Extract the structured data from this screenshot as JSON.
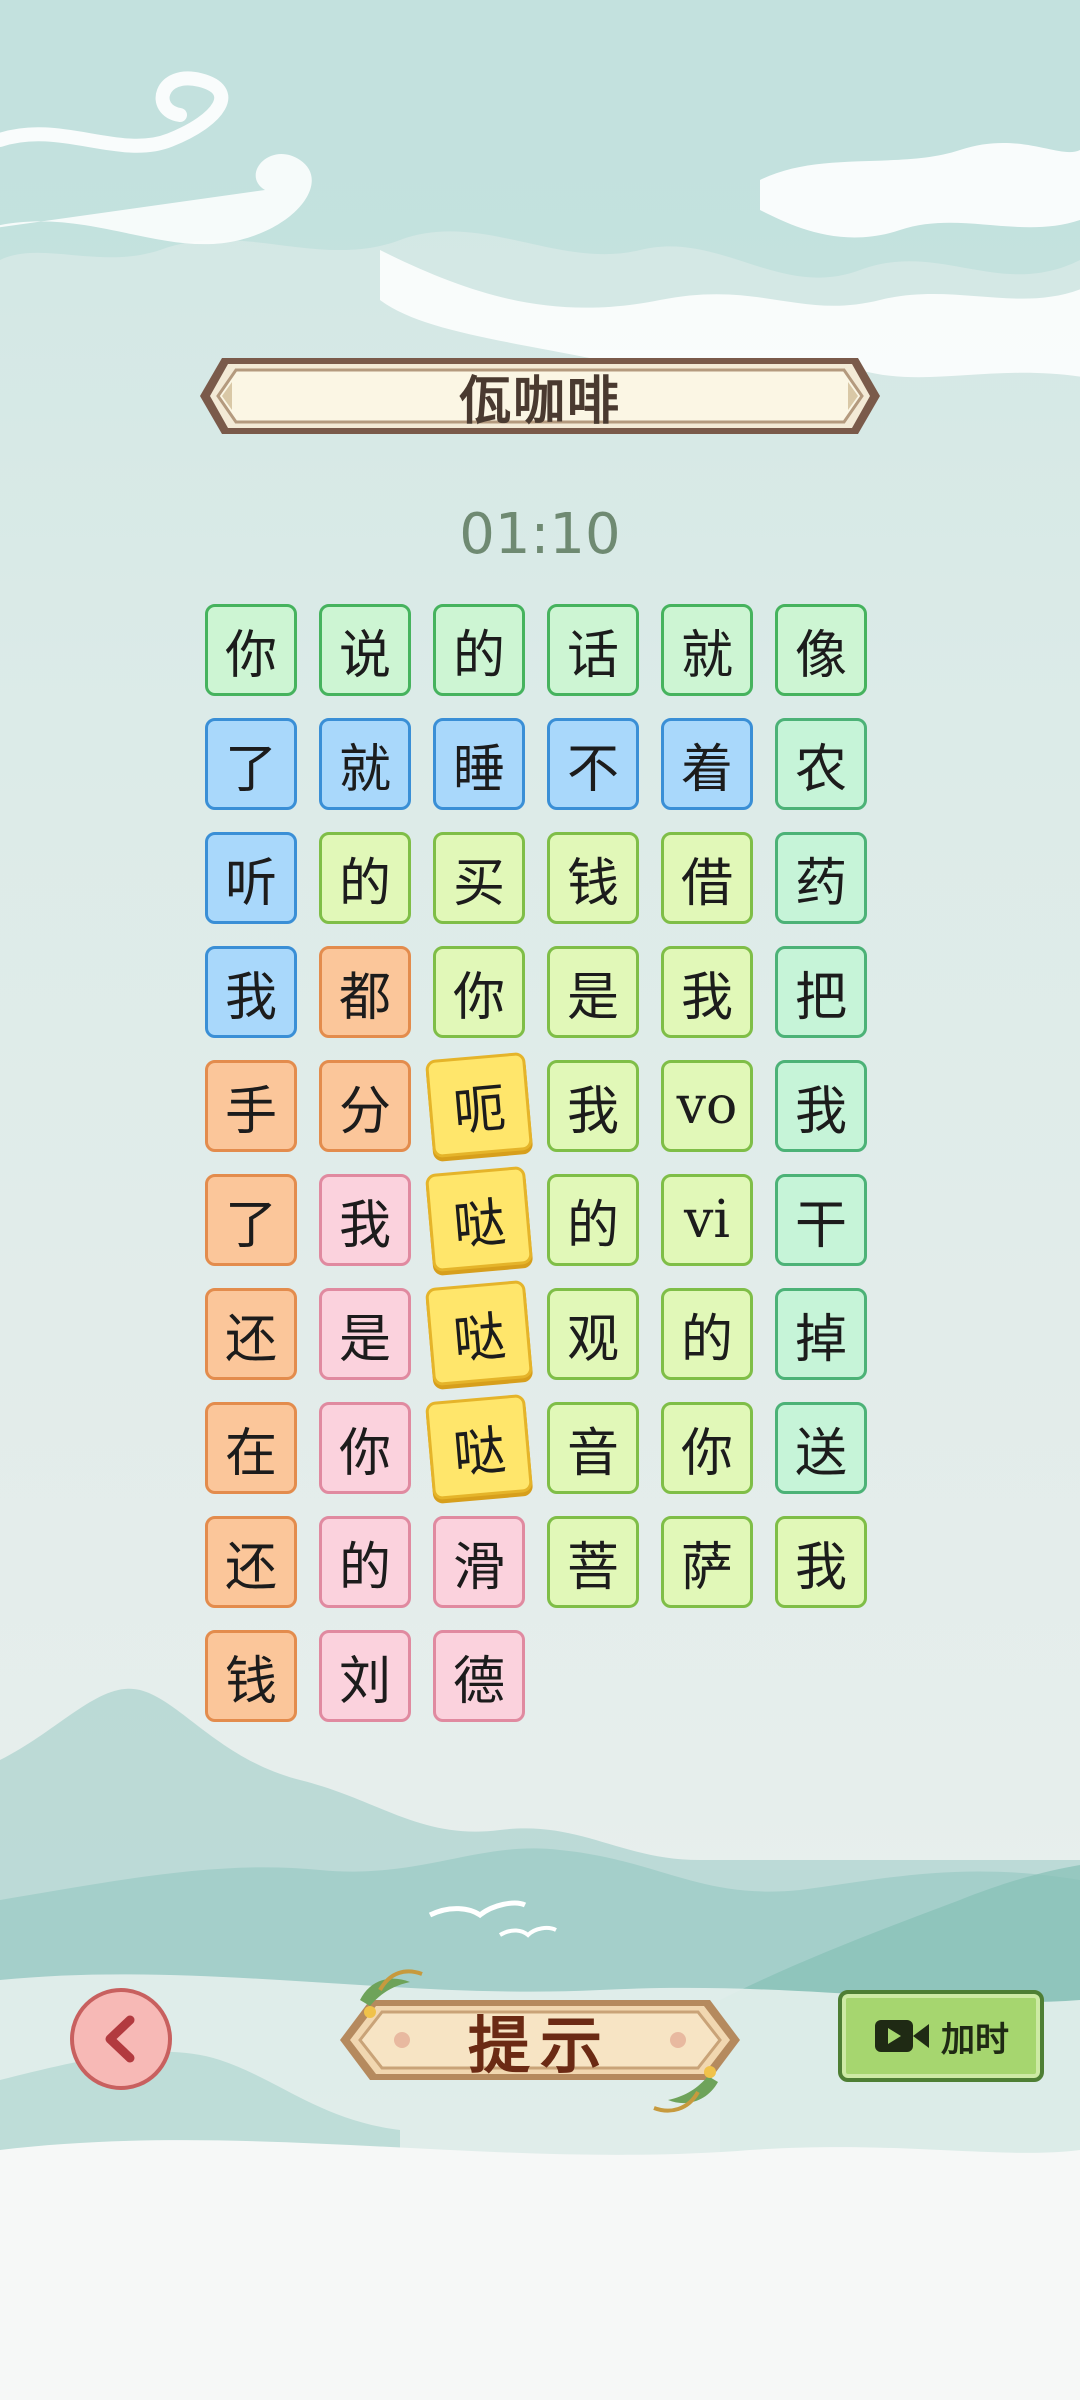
{
  "title": "佤咖啡",
  "timer": "01:10",
  "grid": [
    {
      "t": "你",
      "c": "green"
    },
    {
      "t": "说",
      "c": "green"
    },
    {
      "t": "的",
      "c": "green"
    },
    {
      "t": "话",
      "c": "green"
    },
    {
      "t": "就",
      "c": "green"
    },
    {
      "t": "像",
      "c": "green"
    },
    {
      "t": "了",
      "c": "blue"
    },
    {
      "t": "就",
      "c": "blue"
    },
    {
      "t": "睡",
      "c": "blue"
    },
    {
      "t": "不",
      "c": "blue"
    },
    {
      "t": "着",
      "c": "blue"
    },
    {
      "t": "农",
      "c": "mint"
    },
    {
      "t": "听",
      "c": "blue"
    },
    {
      "t": "的",
      "c": "lime"
    },
    {
      "t": "买",
      "c": "lime"
    },
    {
      "t": "钱",
      "c": "lime"
    },
    {
      "t": "借",
      "c": "lime"
    },
    {
      "t": "药",
      "c": "mint"
    },
    {
      "t": "我",
      "c": "blue"
    },
    {
      "t": "都",
      "c": "orange"
    },
    {
      "t": "你",
      "c": "lime"
    },
    {
      "t": "是",
      "c": "lime"
    },
    {
      "t": "我",
      "c": "lime"
    },
    {
      "t": "把",
      "c": "mint"
    },
    {
      "t": "手",
      "c": "orange"
    },
    {
      "t": "分",
      "c": "orange"
    },
    {
      "t": "呃",
      "c": "yellow"
    },
    {
      "t": "我",
      "c": "lime"
    },
    {
      "t": "vo",
      "c": "lime"
    },
    {
      "t": "我",
      "c": "mint"
    },
    {
      "t": "了",
      "c": "orange"
    },
    {
      "t": "我",
      "c": "pink"
    },
    {
      "t": "哒",
      "c": "yellow"
    },
    {
      "t": "的",
      "c": "lime"
    },
    {
      "t": "vi",
      "c": "lime"
    },
    {
      "t": "干",
      "c": "mint"
    },
    {
      "t": "还",
      "c": "orange"
    },
    {
      "t": "是",
      "c": "pink"
    },
    {
      "t": "哒",
      "c": "yellow"
    },
    {
      "t": "观",
      "c": "lime"
    },
    {
      "t": "的",
      "c": "lime"
    },
    {
      "t": "掉",
      "c": "mint"
    },
    {
      "t": "在",
      "c": "orange"
    },
    {
      "t": "你",
      "c": "pink"
    },
    {
      "t": "哒",
      "c": "yellow"
    },
    {
      "t": "音",
      "c": "lime"
    },
    {
      "t": "你",
      "c": "lime"
    },
    {
      "t": "送",
      "c": "mint"
    },
    {
      "t": "还",
      "c": "orange"
    },
    {
      "t": "的",
      "c": "pink"
    },
    {
      "t": "滑",
      "c": "pink"
    },
    {
      "t": "菩",
      "c": "lime"
    },
    {
      "t": "萨",
      "c": "lime"
    },
    {
      "t": "我",
      "c": "lime"
    },
    {
      "t": "钱",
      "c": "orange"
    },
    {
      "t": "刘",
      "c": "pink"
    },
    {
      "t": "德",
      "c": "pink"
    }
  ],
  "buttons": {
    "back_icon": "chevron-left-icon",
    "hint_label": "提示",
    "add_time_icon": "video-camera-icon",
    "add_time_label": "加时"
  },
  "colors": {
    "green": "#46b35e",
    "blue": "#3a8fd6",
    "lime": "#7fbe47",
    "mint": "#4cb277",
    "orange": "#e38c4d",
    "pink": "#e08aa0",
    "yellow": "#e5b42a"
  }
}
